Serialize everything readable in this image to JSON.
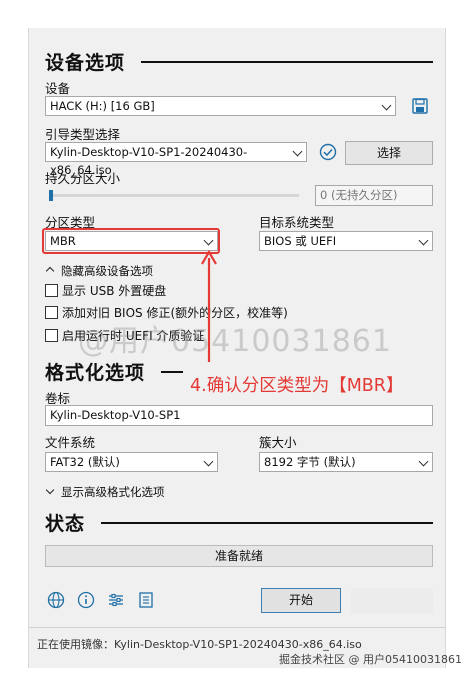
{
  "device_options": {
    "title": "设备选项",
    "device_label": "设备",
    "device_value": "HACK (H:) [16 GB]",
    "boot_label": "引导类型选择",
    "boot_value": "Kylin-Desktop-V10-SP1-20240430-x86_64.iso",
    "select_button": "选择",
    "persistent_label": "持久分区大小",
    "persistent_value": "0 (无持久分区)",
    "partition_label": "分区类型",
    "partition_value": "MBR",
    "target_label": "目标系统类型",
    "target_value": "BIOS 或 UEFI",
    "advanced_toggle": "隐藏高级设备选项",
    "checkboxes": [
      {
        "label": "显示 USB 外置硬盘",
        "checked": false
      },
      {
        "label": "添加对旧 BIOS 修正(额外的分区，校准等)",
        "checked": false
      },
      {
        "label": "启用运行时 UEFI 介质验证",
        "checked": false
      }
    ]
  },
  "format_options": {
    "title": "格式化选项",
    "volume_label": "卷标",
    "volume_value": "Kylin-Desktop-V10-SP1",
    "fs_label": "文件系统",
    "fs_value": "FAT32 (默认)",
    "cluster_label": "簇大小",
    "cluster_value": "8192 字节 (默认)",
    "advanced_toggle": "显示高级格式化选项"
  },
  "status": {
    "title": "状态",
    "progress_text": "准备就绪",
    "progress": 0
  },
  "toolbar": {
    "start_button": "开始",
    "icons": [
      "globe-icon",
      "info-icon",
      "settings-sliders-icon",
      "log-icon"
    ]
  },
  "footer": {
    "status_text": "正在使用镜像：Kylin-Desktop-V10-SP1-20240430-x86_64.iso"
  },
  "annotation": {
    "text": "4.确认分区类型为【MBR】",
    "color": "#e53935"
  },
  "watermarks": {
    "overlay": "@用户05410031861",
    "bottom": "掘金技术社区 @ 用户05410031861"
  }
}
